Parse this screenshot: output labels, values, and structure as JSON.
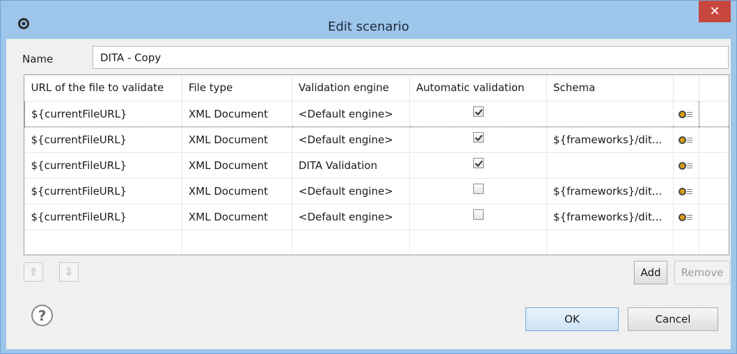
{
  "window": {
    "title": "Edit scenario",
    "close_label": "✕"
  },
  "name_field": {
    "label": "Name",
    "value": "DITA - Copy"
  },
  "table": {
    "headers": [
      "URL of the file to validate",
      "File type",
      "Validation engine",
      "Automatic validation",
      "Schema",
      ""
    ],
    "rows": [
      {
        "url": "${currentFileURL}",
        "file_type": "XML Document",
        "engine": "<Default engine>",
        "auto": true,
        "schema": ""
      },
      {
        "url": "${currentFileURL}",
        "file_type": "XML Document",
        "engine": "<Default engine>",
        "auto": true,
        "schema": "${frameworks}/dit..."
      },
      {
        "url": "${currentFileURL}",
        "file_type": "XML Document",
        "engine": "DITA Validation",
        "auto": true,
        "schema": ""
      },
      {
        "url": "${currentFileURL}",
        "file_type": "XML Document",
        "engine": "<Default engine>",
        "auto": false,
        "schema": "${frameworks}/dit..."
      },
      {
        "url": "${currentFileURL}",
        "file_type": "XML Document",
        "engine": "<Default engine>",
        "auto": false,
        "schema": "${frameworks}/dit..."
      }
    ],
    "selected_row": 0,
    "row_icon": "settings-gear-icon"
  },
  "move_buttons": {
    "up_icon": "⇧",
    "down_icon": "⇩"
  },
  "buttons": {
    "add": "Add",
    "remove": "Remove",
    "ok": "OK",
    "cancel": "Cancel"
  },
  "help_icon_glyph": "?",
  "colors": {
    "titlebar": "#9ec5ea",
    "close": "#c7473f",
    "ok_border": "#6aa6dc"
  }
}
